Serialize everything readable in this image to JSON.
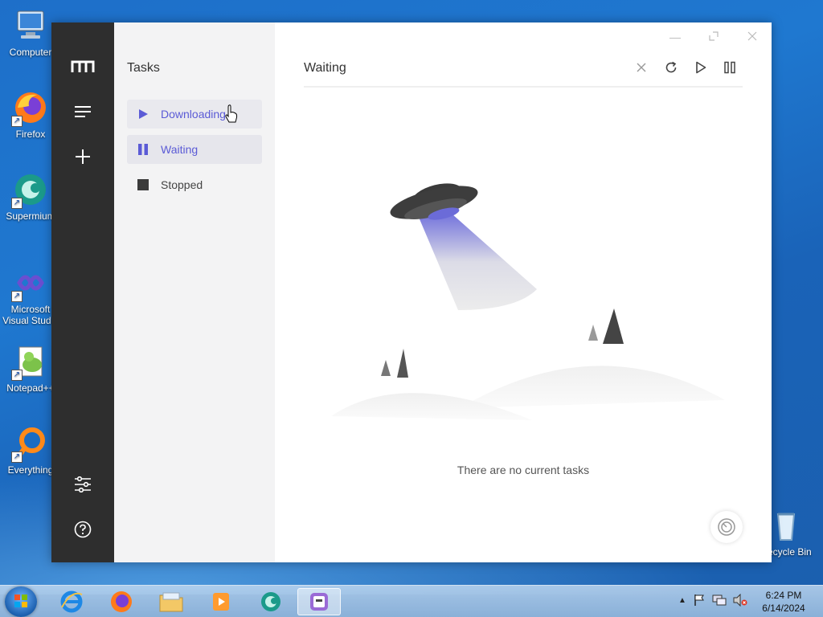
{
  "desktop": {
    "icons": [
      {
        "label": "Computer"
      },
      {
        "label": "Firefox"
      },
      {
        "label": "Supermium"
      },
      {
        "label": "Microsoft Visual Studio"
      },
      {
        "label": "Notepad++"
      },
      {
        "label": "Everything"
      },
      {
        "label": "Recycle Bin"
      }
    ]
  },
  "app": {
    "rail": {
      "logo_icon": "motrix-logo-icon",
      "menu_icon": "hamburger-menu-icon",
      "add_icon": "plus-icon",
      "settings_icon": "sliders-icon",
      "help_icon": "help-circle-icon"
    },
    "sidebar": {
      "title": "Tasks",
      "items": [
        {
          "label": "Downloading",
          "icon": "play-icon"
        },
        {
          "label": "Waiting",
          "icon": "pause-icon"
        },
        {
          "label": "Stopped",
          "icon": "stop-icon"
        }
      ]
    },
    "main": {
      "heading": "Waiting",
      "toolbar": {
        "clear_icon": "close-icon",
        "refresh_icon": "refresh-icon",
        "resume_icon": "play-icon",
        "pause_icon": "pause-icon"
      },
      "empty_message": "There are no current tasks"
    },
    "accent": "#5b5bd6"
  },
  "taskbar": {
    "clock_time": "6:24 PM",
    "clock_date": "6/14/2024"
  }
}
